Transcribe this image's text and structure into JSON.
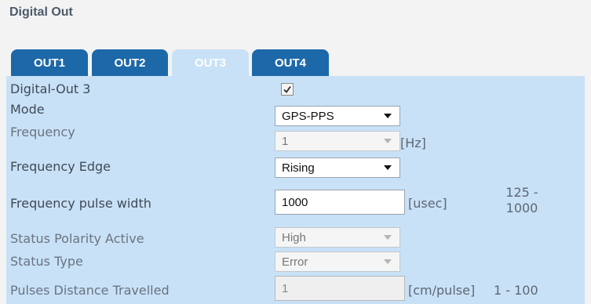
{
  "section": {
    "title": "Digital Out"
  },
  "tabs": [
    {
      "label": "OUT1",
      "active": false
    },
    {
      "label": "OUT2",
      "active": false
    },
    {
      "label": "OUT3",
      "active": true
    },
    {
      "label": "OUT4",
      "active": false
    }
  ],
  "form": {
    "enable": {
      "label": "Digital-Out 3",
      "checked": true
    },
    "mode": {
      "label": "Mode",
      "value": "GPS-PPS"
    },
    "frequency": {
      "label": "Frequency",
      "value": "1",
      "unit": "[Hz]"
    },
    "frequency_edge": {
      "label": "Frequency Edge",
      "value": "Rising"
    },
    "pulse_width": {
      "label": "Frequency pulse width",
      "value": "1000",
      "unit": "[usec]",
      "range_min": "125 -",
      "range_max": "1000"
    },
    "status_polarity": {
      "label": "Status Polarity Active",
      "value": "High"
    },
    "status_type": {
      "label": "Status Type",
      "value": "Error"
    },
    "pulses_distance": {
      "label": "Pulses Distance Travelled",
      "value": "1",
      "unit": "[cm/pulse]",
      "range": "1 - 100"
    }
  },
  "colors": {
    "tab_active": "#1d68a9",
    "tab_selected": "#c8e1f7",
    "panel_bg": "#c8e1f7",
    "page_bg": "#f3f3f3"
  }
}
